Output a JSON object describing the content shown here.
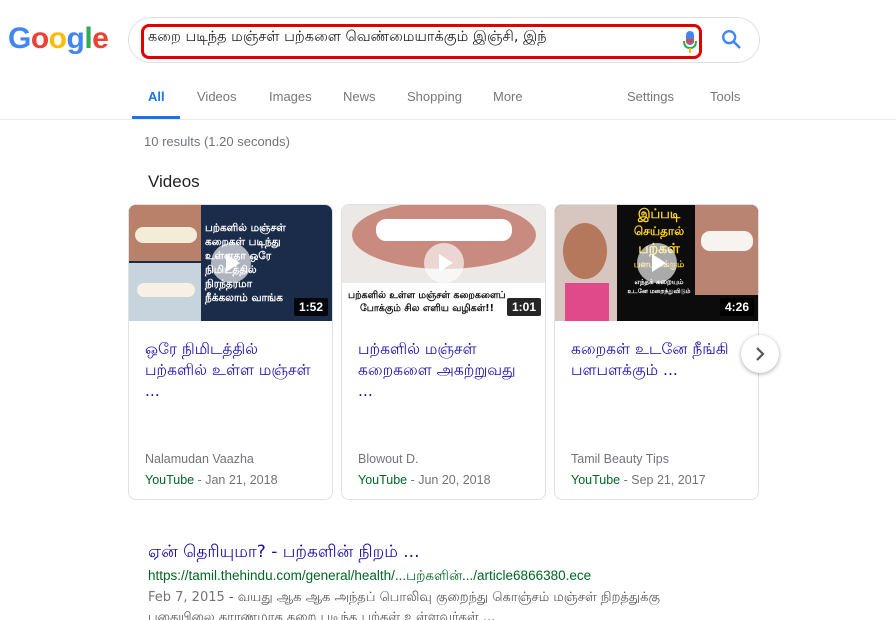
{
  "logo": {
    "letters": [
      "G",
      "o",
      "o",
      "g",
      "l",
      "e"
    ],
    "colors": [
      "#4285f4",
      "#ea4335",
      "#fbbc05",
      "#4285f4",
      "#34a853",
      "#ea4335"
    ]
  },
  "search": {
    "value": "கறை படிந்த மஞ்சள் பற்களை வெண்மையாக்கும் இஞ்சி, இந்",
    "mic_icon": "mic-icon",
    "search_icon": "search-icon"
  },
  "tabs": {
    "left": [
      {
        "label": "All",
        "active": true
      },
      {
        "label": "Videos"
      },
      {
        "label": "Images"
      },
      {
        "label": "News"
      },
      {
        "label": "Shopping"
      },
      {
        "label": "More"
      }
    ],
    "right": [
      {
        "label": "Settings"
      },
      {
        "label": "Tools"
      }
    ]
  },
  "result_stats": "10 results (1.20 seconds)",
  "videos_heading": "Videos",
  "videos": [
    {
      "title": "ஒரே நிமிடத்தில் பற்களில் உள்ள மஞ்சள் ...",
      "duration": "1:52",
      "source": "Nalamudan Vaazha",
      "platform": "YouTube",
      "date": " - Jan 21, 2018",
      "thumb_text": [
        "பற்களில் மஞ்சள்",
        "கறைகள் படிந்து",
        "உள்ளதா ஒரே",
        "நிமிடத்தில்",
        "நிரந்தரமா",
        "நீக்கலாம் வாங்க"
      ]
    },
    {
      "title": "பற்களில் மஞ்சள் கறைகளை அகற்றுவது ...",
      "duration": "1:01",
      "source": "Blowout D.",
      "platform": "YouTube",
      "date": " - Jun 20, 2018",
      "thumb_text": [
        "பற்களில் உள்ள மஞ்சள் கறைகளைப்",
        "போக்கும் சில எளிய வழிகள்!!"
      ]
    },
    {
      "title": "கறைகள் உடனே நீங்கி பளபளக்கும் ...",
      "duration": "4:26",
      "source": "Tamil Beauty Tips",
      "platform": "YouTube",
      "date": " - Sep 21, 2017",
      "thumb_text": [
        "இப்படி",
        "செய்தால்",
        "பற்கள்",
        "பளபளக்கும்",
        "எந்தக் கறையும்",
        "உடனே மறைந்துவிடும்"
      ]
    }
  ],
  "next_icon": "chevron-right-icon",
  "result": {
    "title": "ஏன் தெரியுமா? - பற்களின் நிறம் ...",
    "url": "https://tamil.thehindu.com/general/health/...பற்களின்.../article6866380.ece",
    "date": "Feb 7, 2015",
    "snippet": " - வயது ஆக ஆக அந்தப் பொலிவு குறைந்து கொஞ்சம் மஞ்சள் நிறத்துக்கு",
    "snippet2": "புகையிலை காரணமாக கறை படிந்த பற்கள் உள்ளவர்கள் ..."
  }
}
